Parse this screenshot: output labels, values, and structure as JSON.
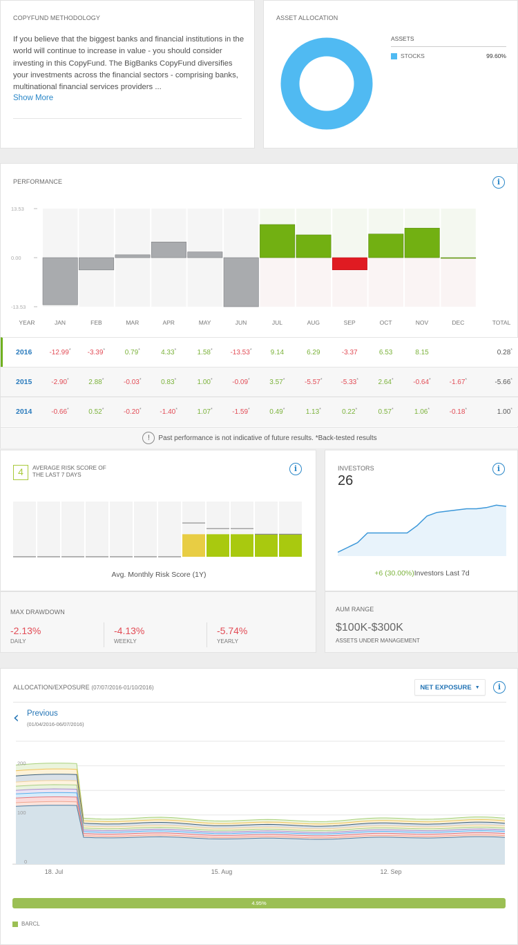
{
  "methodology": {
    "title": "COPYFUND METHODOLOGY",
    "description": "If you believe that the biggest banks and financial institutions in the world will continue to increase in value - you should consider investing in this CopyFund. The BigBanks CopyFund diversifies your investments across the financial sectors - comprising banks, multinational financial services providers ...",
    "show_more": "Show More"
  },
  "asset_allocation": {
    "title": "ASSET ALLOCATION",
    "assets_header": "ASSETS",
    "items": [
      {
        "label": "STOCKS",
        "value": "99.60%",
        "fraction": 0.996,
        "color": "#50baf2"
      }
    ]
  },
  "performance": {
    "title": "PERFORMANCE",
    "info_icon": "info-icon",
    "y_ticks": [
      "13.53",
      "0.00",
      "-13.53"
    ],
    "year_header": "YEAR",
    "total_header": "TOTAL",
    "months": [
      "JAN",
      "FEB",
      "MAR",
      "APR",
      "MAY",
      "JUN",
      "JUL",
      "AUG",
      "SEP",
      "OCT",
      "NOV",
      "DEC"
    ],
    "rows": [
      {
        "year": "2016",
        "values": [
          "-12.99",
          "-3.39",
          "0.79",
          "4.33",
          "1.58",
          "-13.53",
          "9.14",
          "6.29",
          "-3.37",
          "6.53",
          "8.15",
          ""
        ],
        "backtested": [
          true,
          true,
          true,
          true,
          true,
          true,
          false,
          false,
          false,
          false,
          false,
          false
        ],
        "total": "0.28"
      },
      {
        "year": "2015",
        "values": [
          "-2.90",
          "2.88",
          "-0.03",
          "0.83",
          "1.00",
          "-0.09",
          "3.57",
          "-5.57",
          "-5.33",
          "2.64",
          "-0.64",
          "-1.67"
        ],
        "backtested": [
          true,
          true,
          true,
          true,
          true,
          true,
          true,
          true,
          true,
          true,
          true,
          true
        ],
        "total": "-5.66"
      },
      {
        "year": "2014",
        "values": [
          "-0.66",
          "0.52",
          "-0.20",
          "-1.40",
          "1.07",
          "-1.59",
          "0.49",
          "1.13",
          "0.22",
          "0.57",
          "1.06",
          "-0.18"
        ],
        "backtested": [
          true,
          true,
          true,
          true,
          true,
          true,
          true,
          true,
          true,
          true,
          true,
          true
        ],
        "total": "1.00"
      }
    ],
    "note": "Past performance is not indicative of future results. *Back-tested results",
    "colors": {
      "positive": "#72b012",
      "negative": "#e01b22",
      "backtested": "#a9abae"
    }
  },
  "chart_data": [
    {
      "type": "bar",
      "title": "PERFORMANCE",
      "categories": [
        "JAN",
        "FEB",
        "MAR",
        "APR",
        "MAY",
        "JUN",
        "JUL",
        "AUG",
        "SEP",
        "OCT",
        "NOV",
        "DEC"
      ],
      "values": [
        -12.99,
        -3.39,
        0.79,
        4.33,
        1.58,
        -13.53,
        9.14,
        6.29,
        -3.37,
        6.53,
        8.15,
        0.0
      ],
      "ylim": [
        -13.53,
        13.53
      ],
      "yticks": [
        13.53,
        0.0,
        -13.53
      ]
    },
    {
      "type": "bar",
      "title": "Avg. Monthly Risk Score (1Y)",
      "categories": [
        "1",
        "2",
        "3",
        "4",
        "5",
        "6",
        "7",
        "8",
        "9",
        "10",
        "11",
        "12"
      ],
      "values": [
        0,
        0,
        0,
        0,
        0,
        0,
        0,
        4,
        4,
        4,
        4,
        4
      ],
      "max_marker": [
        0,
        0,
        0,
        0,
        0,
        0,
        0,
        6,
        5,
        5,
        4,
        4
      ],
      "ylim": [
        0,
        10
      ]
    },
    {
      "type": "area",
      "title": "INVESTORS",
      "values": [
        1,
        3,
        5,
        9,
        9,
        9,
        9,
        9,
        12,
        16,
        17.5,
        18,
        18.5,
        19,
        19,
        19.5,
        20.5,
        20
      ]
    },
    {
      "type": "area",
      "title": "ALLOCATION/EXPOSURE",
      "x_ticks": [
        "18. Jul",
        "15. Aug",
        "12. Sep"
      ],
      "yticks": [
        0,
        100,
        200
      ],
      "ylim": [
        0,
        250
      ],
      "series_count": 10,
      "total_before": 210,
      "total_after": 95
    }
  ],
  "risk": {
    "score": "4",
    "label": "AVERAGE RISK SCORE OF THE LAST 7 DAYS",
    "caption": "Avg. Monthly Risk Score (1Y)"
  },
  "drawdown": {
    "title": "MAX DRAWDOWN",
    "items": [
      {
        "value": "-2.13%",
        "label": "DAILY"
      },
      {
        "value": "-4.13%",
        "label": "WEEKLY"
      },
      {
        "value": "-5.74%",
        "label": "YEARLY"
      }
    ]
  },
  "investors": {
    "title": "INVESTORS",
    "count": "26",
    "change": "+6 (30.00%)",
    "change_label": "Investors Last 7d"
  },
  "aum": {
    "title": "AUM RANGE",
    "value": "$100K-$300K",
    "label": "ASSETS UNDER MANAGEMENT"
  },
  "allocation": {
    "title": "ALLOCATION/EXPOSURE",
    "date_range": "(07/07/2016-01/10/2016)",
    "dropdown": "NET EXPOSURE",
    "previous_label": "Previous",
    "previous_range": "(01/04/2016-06/07/2016)",
    "bar_value": "4.95%",
    "legend": [
      {
        "label": "BARCL",
        "color": "#9bbf54"
      }
    ]
  }
}
